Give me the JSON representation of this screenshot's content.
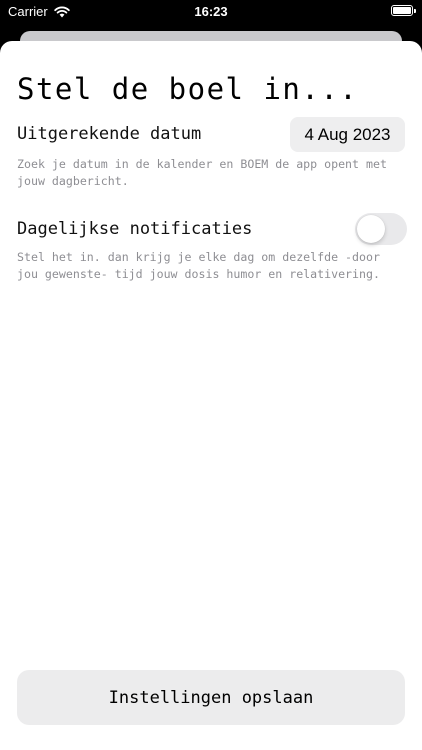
{
  "status_bar": {
    "carrier": "Carrier",
    "time": "16:23",
    "wifi_icon": "wifi-icon",
    "battery_icon": "battery-icon"
  },
  "settings": {
    "title": "Stel de boel in...",
    "due_date": {
      "label": "Uitgerekende datum",
      "value": "4 Aug 2023",
      "help": "Zoek je datum in de kalender en BOEM de app opent met jouw dagbericht."
    },
    "notifications": {
      "label": "Dagelijkse notificaties",
      "enabled": false,
      "help": "Stel het in. dan krijg je elke dag om dezelfde -door jou gewenste- tijd jouw dosis humor en relativering."
    },
    "save_label": "Instellingen opslaan"
  }
}
